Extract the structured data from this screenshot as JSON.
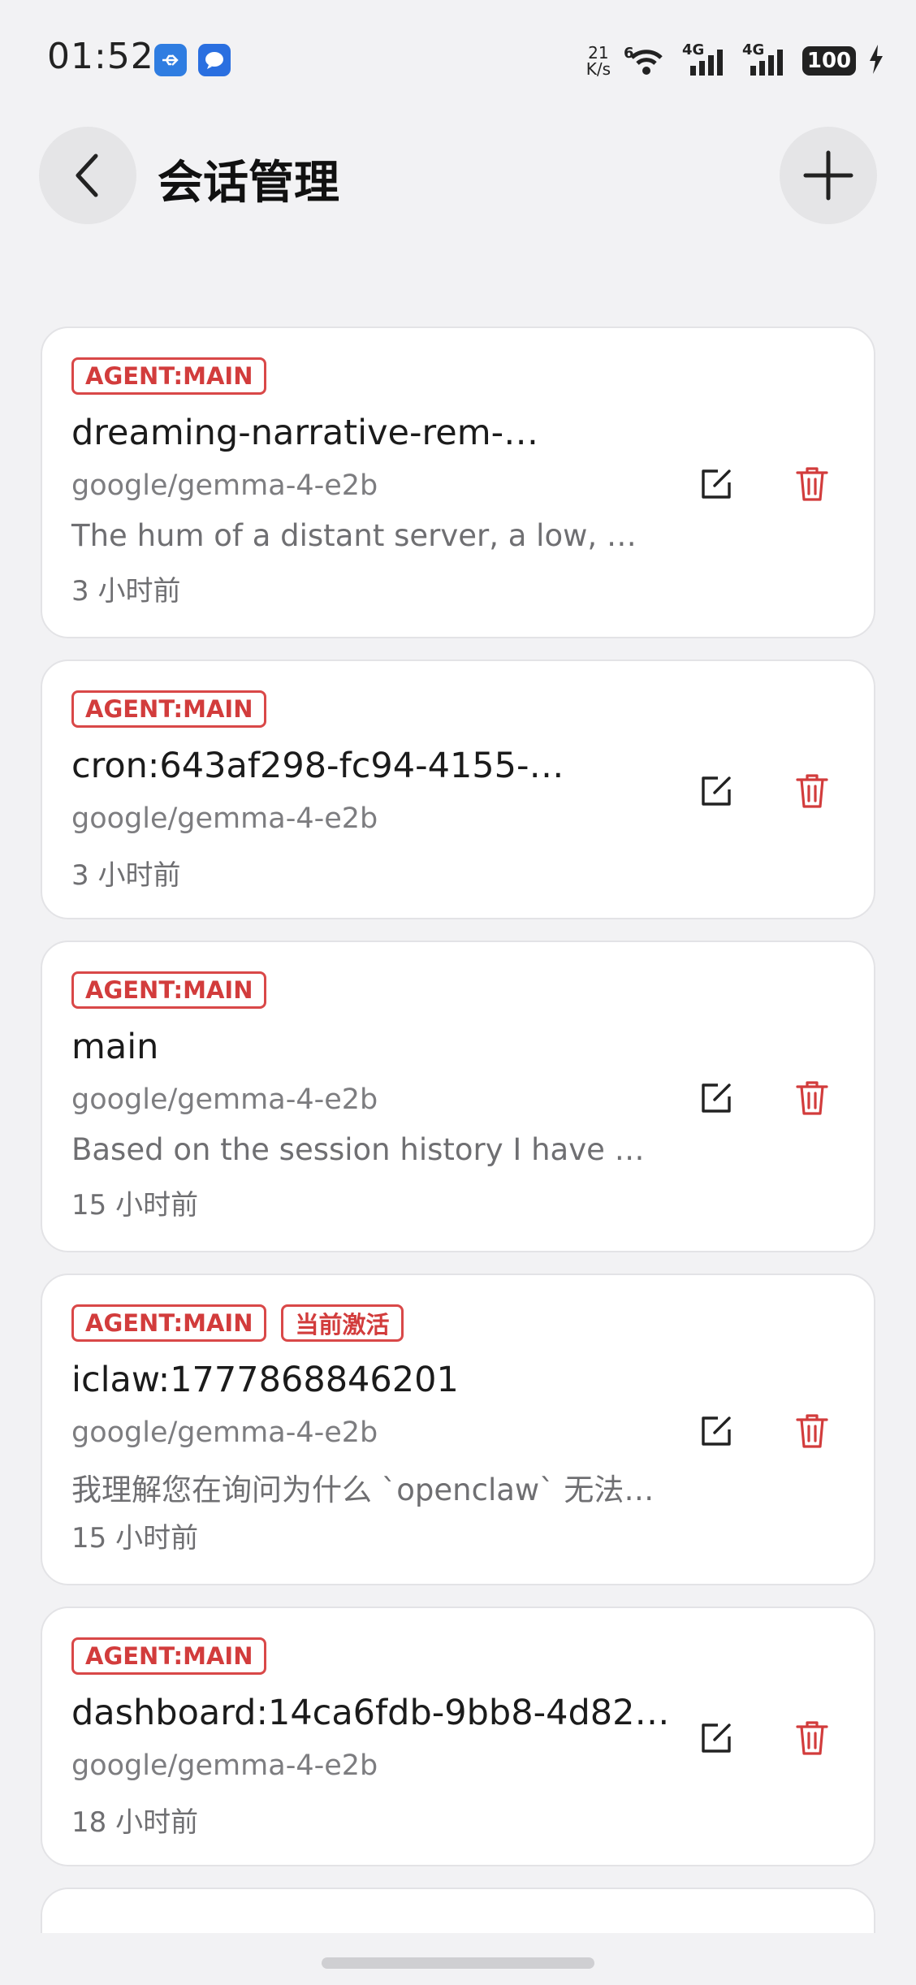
{
  "status": {
    "time": "01:52",
    "net_speed_value": "21",
    "net_speed_unit": "K/s",
    "wifi_label": "6",
    "sim1_label": "4G",
    "sim2_label": "4G",
    "battery": "100"
  },
  "header": {
    "title": "会话管理"
  },
  "sessions": [
    {
      "tags": [
        "AGENT:MAIN"
      ],
      "title": "dreaming-narrative-rem-…",
      "model": "google/gemma-4-e2b",
      "preview": "The hum of a distant server, a low, …",
      "time": "3 小时前"
    },
    {
      "tags": [
        "AGENT:MAIN"
      ],
      "title": "cron:643af298-fc94-4155-…",
      "model": "google/gemma-4-e2b",
      "preview": "",
      "time": "3 小时前"
    },
    {
      "tags": [
        "AGENT:MAIN"
      ],
      "title": "main",
      "model": "google/gemma-4-e2b",
      "preview": "Based on the session history I have …",
      "time": "15 小时前"
    },
    {
      "tags": [
        "AGENT:MAIN",
        "当前激活"
      ],
      "title": "iclaw:1777868846201",
      "model": "google/gemma-4-e2b",
      "preview": "我理解您在询问为什么 `openclaw` 无法…",
      "time": "15 小时前"
    },
    {
      "tags": [
        "AGENT:MAIN"
      ],
      "title": "dashboard:14ca6fdb-9bb8-4d82…",
      "model": "google/gemma-4-e2b",
      "preview": "",
      "time": "18 小时前"
    }
  ],
  "colors": {
    "accent_red": "#d23c3c",
    "background": "#f2f2f4",
    "card": "#ffffff"
  },
  "icons": {
    "back": "chevron-left-icon",
    "add": "plus-icon",
    "edit": "edit-icon",
    "delete": "trash-icon"
  }
}
